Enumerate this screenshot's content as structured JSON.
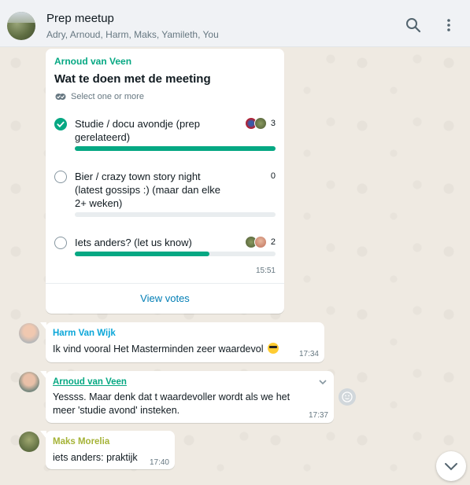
{
  "header": {
    "title": "Prep meetup",
    "participants": "Adry, Arnoud, Harm, Maks, Yamileth, You",
    "search_icon": "search-icon",
    "menu_icon": "more-vertical-icon"
  },
  "poll": {
    "sender": "Arnoud van Veen",
    "title": "Wat te doen met de meeting",
    "hint": "Select one or more",
    "options": [
      {
        "label": "Studie / docu avondje (prep gerelateerd)",
        "count": "3",
        "checked": true,
        "fill_fraction": 1.0
      },
      {
        "label": "Bier / crazy town story night (latest gossips :) (maar dan elke 2+ weken)",
        "count": "0",
        "checked": false,
        "fill_fraction": 0.0
      },
      {
        "label": "Iets anders? (let us know)",
        "count": "2",
        "checked": false,
        "fill_fraction": 0.67
      }
    ],
    "time": "15:51",
    "view_votes": "View votes"
  },
  "messages": [
    {
      "sender": "Harm Van Wijk",
      "sender_color": "#0aa6d8",
      "text": "Ik vind vooral Het Masterminden zeer waardevol",
      "emoji": "sunglasses-emoji",
      "time": "17:34"
    },
    {
      "sender": "Arnoud van Veen",
      "sender_color": "#06a883",
      "text": "Yessss. Maar denk dat t waardevoller wordt als we het meer 'studie avond' insteken.",
      "time": "17:37"
    },
    {
      "sender": "Maks Morelia",
      "sender_color": "#a5b337",
      "text": "iets anders: praktijk",
      "time": "17:40"
    }
  ],
  "colors": {
    "accent": "#06a883",
    "link": "#027eb5",
    "chat_bg": "#efeae2"
  }
}
